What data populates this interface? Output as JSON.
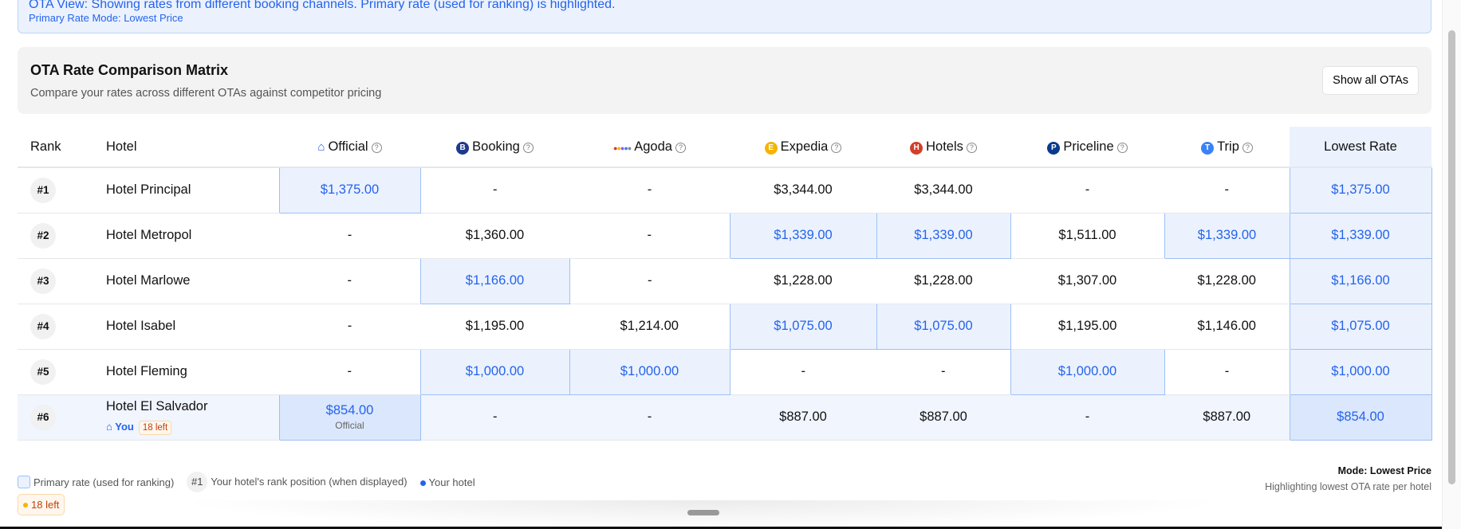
{
  "banner": {
    "line1": "OTA View: Showing rates from different booking channels. Primary rate (used for ranking) is highlighted.",
    "line2": "Primary Rate Mode: Lowest Price"
  },
  "card": {
    "title": "OTA Rate Comparison Matrix",
    "subtitle": "Compare your rates across different OTAs against competitor pricing",
    "show_all_label": "Show all OTAs"
  },
  "columns": {
    "rank": "Rank",
    "hotel": "Hotel",
    "lowest": "Lowest Rate",
    "otas": [
      {
        "label": "Official",
        "icon": "home-icon",
        "color": "#2563eb"
      },
      {
        "label": "Booking",
        "icon": "B",
        "color": "#1e3a8a"
      },
      {
        "label": "Agoda",
        "icon": "agoda-dots-icon",
        "color": "#888"
      },
      {
        "label": "Expedia",
        "icon": "E",
        "color": "#f5b400"
      },
      {
        "label": "Hotels",
        "icon": "H",
        "color": "#d0402a"
      },
      {
        "label": "Priceline",
        "icon": "P",
        "color": "#0b3a8c"
      },
      {
        "label": "Trip",
        "icon": "T",
        "color": "#3b82f6"
      }
    ],
    "help_icon": "?"
  },
  "rows": [
    {
      "rank": "#1",
      "hotel": "Hotel Principal",
      "rates": [
        "$1,375.00",
        "-",
        "-",
        "$3,344.00",
        "$3,344.00",
        "-",
        "-"
      ],
      "primary": [
        0
      ],
      "lowest": "$1,375.00"
    },
    {
      "rank": "#2",
      "hotel": "Hotel Metropol",
      "rates": [
        "-",
        "$1,360.00",
        "-",
        "$1,339.00",
        "$1,339.00",
        "$1,511.00",
        "$1,339.00"
      ],
      "primary": [
        3,
        4,
        6
      ],
      "lowest": "$1,339.00"
    },
    {
      "rank": "#3",
      "hotel": "Hotel Marlowe",
      "rates": [
        "-",
        "$1,166.00",
        "-",
        "$1,228.00",
        "$1,228.00",
        "$1,307.00",
        "$1,228.00"
      ],
      "primary": [
        1
      ],
      "lowest": "$1,166.00"
    },
    {
      "rank": "#4",
      "hotel": "Hotel Isabel",
      "rates": [
        "-",
        "$1,195.00",
        "$1,214.00",
        "$1,075.00",
        "$1,075.00",
        "$1,195.00",
        "$1,146.00"
      ],
      "primary": [
        3,
        4
      ],
      "lowest": "$1,075.00"
    },
    {
      "rank": "#5",
      "hotel": "Hotel Fleming",
      "rates": [
        "-",
        "$1,000.00",
        "$1,000.00",
        "-",
        "-",
        "$1,000.00",
        "-"
      ],
      "primary": [
        1,
        2,
        5
      ],
      "lowest": "$1,000.00"
    },
    {
      "rank": "#6",
      "hotel": "Hotel El Salvador",
      "you": true,
      "you_label": "You",
      "left_badge": "18 left",
      "rates": [
        "$854.00",
        "-",
        "-",
        "$887.00",
        "$887.00",
        "-",
        "$887.00"
      ],
      "rate_sub": "Official",
      "primary": [
        0
      ],
      "lowest": "$854.00"
    }
  ],
  "legend": {
    "primary": "Primary rate (used for ranking)",
    "rank_sample": "#1",
    "rank_desc": "Your hotel's rank position (when displayed)",
    "your_hotel": "Your hotel",
    "left_badge": "18 left"
  },
  "mode": {
    "title": "Mode: Lowest Price",
    "desc": "Highlighting lowest OTA rate per hotel"
  },
  "colors": {
    "accent": "#2563eb",
    "highlight_bg": "#ebf2fe",
    "warning": "#c2410c"
  }
}
